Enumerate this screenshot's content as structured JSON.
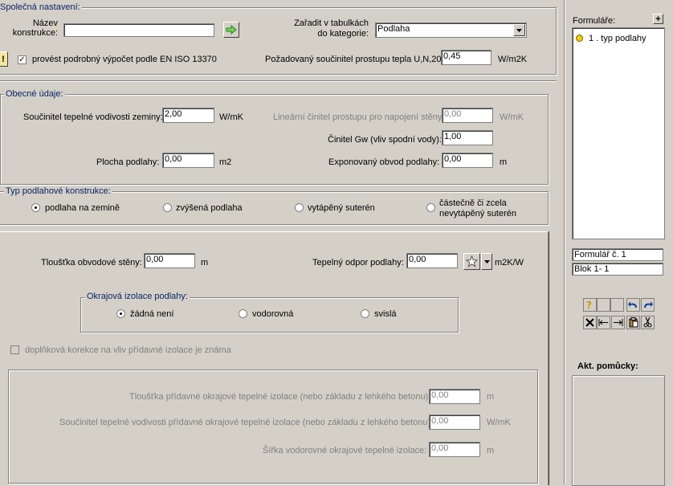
{
  "common": {
    "legend": "Společná nastavení:",
    "name_label_1": "Název",
    "name_label_2": "konstrukce:",
    "name_value": "",
    "category_label_1": "Zařadit v tabulkách",
    "category_label_2": "do kategorie:",
    "category_value": "Podlaha",
    "detailed_calc_label": "provést podrobný výpočet podle EN ISO 13370",
    "required_u_label": "Požadovaný součinitel prostupu tepla U,N,20:",
    "required_u_value": "0,45",
    "required_u_unit": "W/m2K",
    "warning_glyph": "!"
  },
  "general": {
    "legend": "Obecné údaje:",
    "soil_conductivity_label": "Součinitel tepelné vodivosti zeminy:",
    "soil_conductivity_value": "2,00",
    "soil_conductivity_unit": "W/mK",
    "linear_label": "Lineární činitel prostupu pro napojení stěny:",
    "linear_value": "0,00",
    "linear_unit": "W/mK",
    "gw_label": "Činitel Gw (vliv spodní vody):",
    "gw_value": "1,00",
    "floor_area_label": "Plocha podlahy:",
    "floor_area_value": "0,00",
    "floor_area_unit": "m2",
    "perimeter_label": "Exponovaný obvod podlahy:",
    "perimeter_value": "0,00",
    "perimeter_unit": "m"
  },
  "floor_type": {
    "legend": "Typ podlahové konstrukce:",
    "opt1": "podlaha na zemině",
    "opt2": "zvýšená podlaha",
    "opt3": "vytápěný suterén",
    "opt4_1": "částečně či zcela",
    "opt4_2": "nevytápěný suterén"
  },
  "ground_floor": {
    "wall_thickness_label": "Tloušťka obvodové stěny:",
    "wall_thickness_value": "0,00",
    "wall_thickness_unit": "m",
    "resistance_label": "Tepelný odpor podlahy:",
    "resistance_value": "0,00",
    "resistance_unit": "m2K/W",
    "edge_legend": "Okrajová izolace podlahy:",
    "edge_opt1": "žádná není",
    "edge_opt2": "vodorovná",
    "edge_opt3": "svislá",
    "extra_correction_label": "doplňková korekce na vliv přídavné izolace je známa",
    "extra_thickness_label": "Tloušťka přídavné okrajové tepelné izolace (nebo základu z lehkého betonu):",
    "extra_thickness_value": "0,00",
    "extra_thickness_unit": "m",
    "extra_conductivity_label": "Součinitel tepelné vodivosti přídavné okrajové tepelné izolace (nebo základu z lehkého betonu):",
    "extra_conductivity_value": "0,00",
    "extra_conductivity_unit": "W/mK",
    "extra_width_label": "Šířka vodorovné okrajové tepelné izolace:",
    "extra_width_value": "0,00",
    "extra_width_unit": "m"
  },
  "sidebar": {
    "forms_label": "Formuláře:",
    "add_glyph": "+",
    "form_item": "1 . typ podlahy",
    "form_number": "Formulář č.  1",
    "block": "Blok  1-  1",
    "tools_label": "Akt. pomůcky:"
  },
  "colors": {
    "face": "#d4d0c8",
    "legend_text": "#0a246a",
    "accent_green": "#2e9b2e",
    "accent_yellow": "#f0d000"
  }
}
